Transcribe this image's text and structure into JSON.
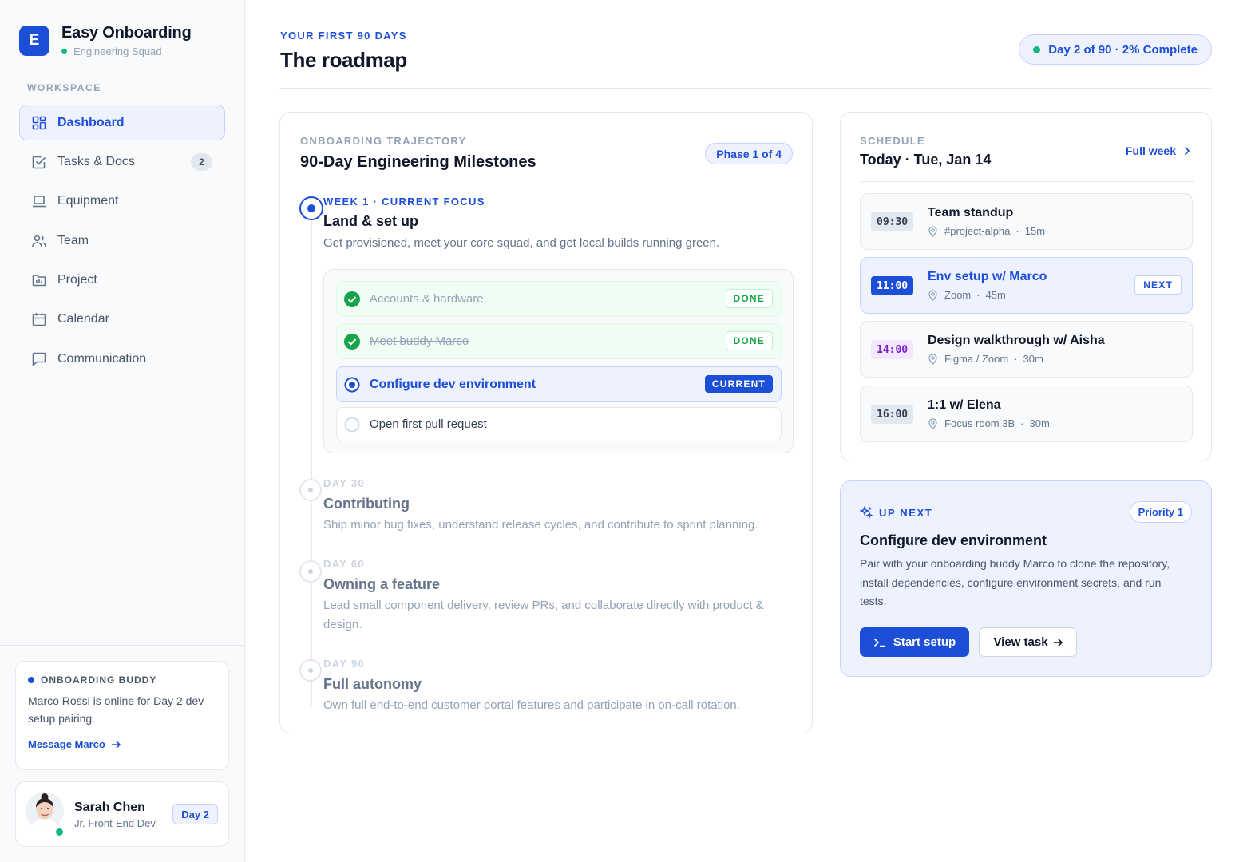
{
  "app": {
    "name": "Easy Onboarding",
    "logo_letter": "E",
    "team": "Engineering Squad"
  },
  "sidebar": {
    "section_label": "WORKSPACE",
    "items": [
      {
        "label": "Dashboard",
        "icon": "dashboard-icon",
        "active": true
      },
      {
        "label": "Tasks & Docs",
        "icon": "checkbox-icon",
        "badge": "2"
      },
      {
        "label": "Equipment",
        "icon": "laptop-icon"
      },
      {
        "label": "Team",
        "icon": "users-icon"
      },
      {
        "label": "Project",
        "icon": "folder-icon"
      },
      {
        "label": "Calendar",
        "icon": "calendar-icon"
      },
      {
        "label": "Communication",
        "icon": "chat-icon"
      }
    ],
    "buddy": {
      "title": "ONBOARDING BUDDY",
      "text": "Marco Rossi is online for Day 2 dev setup pairing.",
      "link": "Message Marco"
    },
    "user": {
      "name": "Sarah Chen",
      "role": "Jr. Front-End Dev",
      "badge": "Day 2"
    }
  },
  "header": {
    "eyebrow": "YOUR FIRST 90 DAYS",
    "title": "The roadmap",
    "progress": "Day 2 of 90 · 2% Complete",
    "progress_percent": 2
  },
  "roadmap": {
    "eyebrow": "ONBOARDING TRAJECTORY",
    "title": "90-Day Engineering Milestones",
    "phase_pill": "Phase 1 of 4",
    "phases": [
      {
        "eyebrow": "WEEK 1 · CURRENT FOCUS",
        "name": "Land & set up",
        "desc": "Get provisioned, meet your core squad, and get local builds running green."
      },
      {
        "eyebrow": "DAY 30",
        "name": "Contributing",
        "desc": "Ship minor bug fixes, understand release cycles, and contribute to sprint planning."
      },
      {
        "eyebrow": "DAY 60",
        "name": "Owning a feature",
        "desc": "Lead small component delivery, review PRs, and collaborate directly with product & design."
      },
      {
        "eyebrow": "DAY 90",
        "name": "Full autonomy",
        "desc": "Own full end-to-end customer portal features and participate in on-call rotation."
      }
    ],
    "tasks": [
      {
        "label": "Accounts & hardware",
        "status": "DONE"
      },
      {
        "label": "Meet buddy Marco",
        "status": "DONE"
      },
      {
        "label": "Configure dev environment",
        "status": "CURRENT"
      },
      {
        "label": "Open first pull request",
        "status": ""
      }
    ]
  },
  "schedule": {
    "eyebrow": "SCHEDULE",
    "title": "Today · Tue, Jan 14",
    "full_week": "Full week",
    "events": [
      {
        "time": "09:30",
        "title": "Team standup",
        "location": "#project-alpha",
        "duration": "15m"
      },
      {
        "time": "11:00",
        "title": "Env setup w/ Marco",
        "location": "Zoom",
        "duration": "45m",
        "tag": "NEXT"
      },
      {
        "time": "14:00",
        "title": "Design walkthrough w/ Aisha",
        "location": "Figma / Zoom",
        "duration": "30m"
      },
      {
        "time": "16:00",
        "title": "1:1 w/ Elena",
        "location": "Focus room 3B",
        "duration": "30m"
      }
    ]
  },
  "up_next": {
    "eyebrow": "UP NEXT",
    "priority": "Priority 1",
    "title": "Configure dev environment",
    "desc": "Pair with your onboarding buddy Marco to clone the repository, install dependencies, configure environment secrets, and run tests.",
    "primary_button": "Start setup",
    "secondary_button": "View task"
  },
  "colors": {
    "accent": "#1d4ed8",
    "success": "#16a34a",
    "online": "#10b981",
    "purple": "#7e22ce"
  }
}
